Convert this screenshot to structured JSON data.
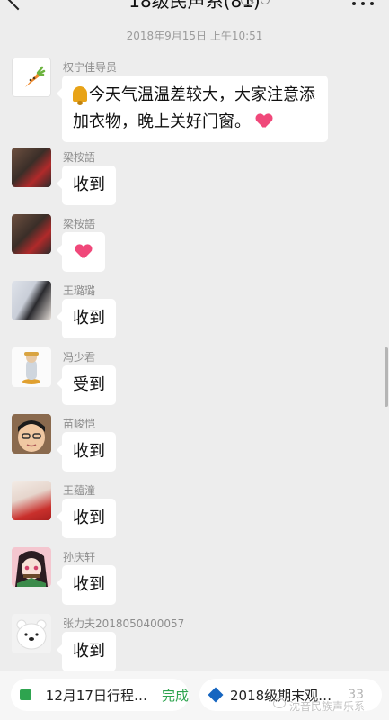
{
  "header": {
    "title": "18级民声系(81)",
    "icons": [
      "back-icon",
      "mute-icon",
      "wand-icon",
      "more-icon"
    ]
  },
  "timestamp": "2018年9月15日 上午10:51",
  "messages": [
    {
      "sender": "权宁佳导员",
      "text": "今天气温温差较大，大家注意添加衣物，晚上关好门窗。",
      "line1": "今天气温温差较大，大家注意添",
      "line2": "加衣物，晚上关好门窗。",
      "emoji_before": "bell",
      "emoji_after": "heart"
    },
    {
      "sender": "梁桉語",
      "text": "收到"
    },
    {
      "sender": "梁桉語",
      "text": "",
      "emoji": "heart"
    },
    {
      "sender": "王璐璐",
      "text": "收到"
    },
    {
      "sender": "冯少君",
      "text": "受到"
    },
    {
      "sender": "苗峻恺",
      "text": "收到"
    },
    {
      "sender": "王蕴潼",
      "text": "收到"
    },
    {
      "sender": "孙庆轩",
      "text": "收到"
    },
    {
      "sender": "张力夫2018050400057",
      "text": "收到"
    }
  ],
  "bottom_bar": {
    "todo_label": "12月17日行程…",
    "todo_status": "完成",
    "doc_label": "2018级期末观…",
    "member_count": "33"
  },
  "watermark": "沈音民族声乐系",
  "colors": {
    "background": "#ededed",
    "bubble": "#ffffff",
    "accent_green": "#2ea44f",
    "heart": "#f0487a"
  }
}
